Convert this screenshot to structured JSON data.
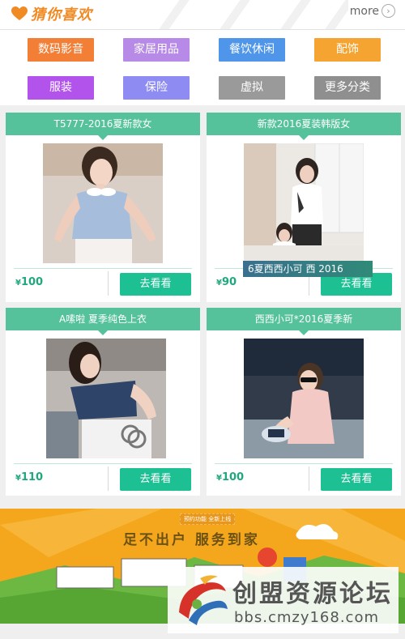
{
  "header": {
    "title": "猜你喜欢",
    "more_label": "more",
    "more_icon": "chevron-right-icon"
  },
  "categories": [
    {
      "label": "数码影音",
      "color": "#f37e36"
    },
    {
      "label": "家居用品",
      "color": "#b78ae8"
    },
    {
      "label": "餐饮休闲",
      "color": "#4f96ea"
    },
    {
      "label": "配饰",
      "color": "#f6a431"
    },
    {
      "label": "服装",
      "color": "#b253ec"
    },
    {
      "label": "保险",
      "color": "#8e8cf3"
    },
    {
      "label": "虚拟",
      "color": "#9a9a9a"
    },
    {
      "label": "更多分类",
      "color": "#8f8f8f"
    }
  ],
  "products": [
    {
      "title": "T5777-2016夏新款女",
      "currency": "¥",
      "price": "100",
      "button": "去看看"
    },
    {
      "title": "新款2016夏装韩版女",
      "currency": "¥",
      "price": "90",
      "button": "去看看"
    },
    {
      "title": "A嗦啦 夏季纯色上衣",
      "currency": "¥",
      "price": "110",
      "button": "去看看"
    },
    {
      "title": "西西小可*2016夏季新",
      "currency": "¥",
      "price": "100",
      "button": "去看看"
    }
  ],
  "overlay_text": "6夏西西小可 西 2016",
  "banner": {
    "tag": "预约功能 全新上线",
    "slogan": "足不出户 服务到家"
  },
  "watermark": {
    "name": "创盟资源论坛",
    "url": "bbs.cmzy168.com"
  },
  "colors": {
    "accent": "#55c29c",
    "button": "#1cc093",
    "title_orange": "#f08a24",
    "banner": "#f4a71c"
  }
}
